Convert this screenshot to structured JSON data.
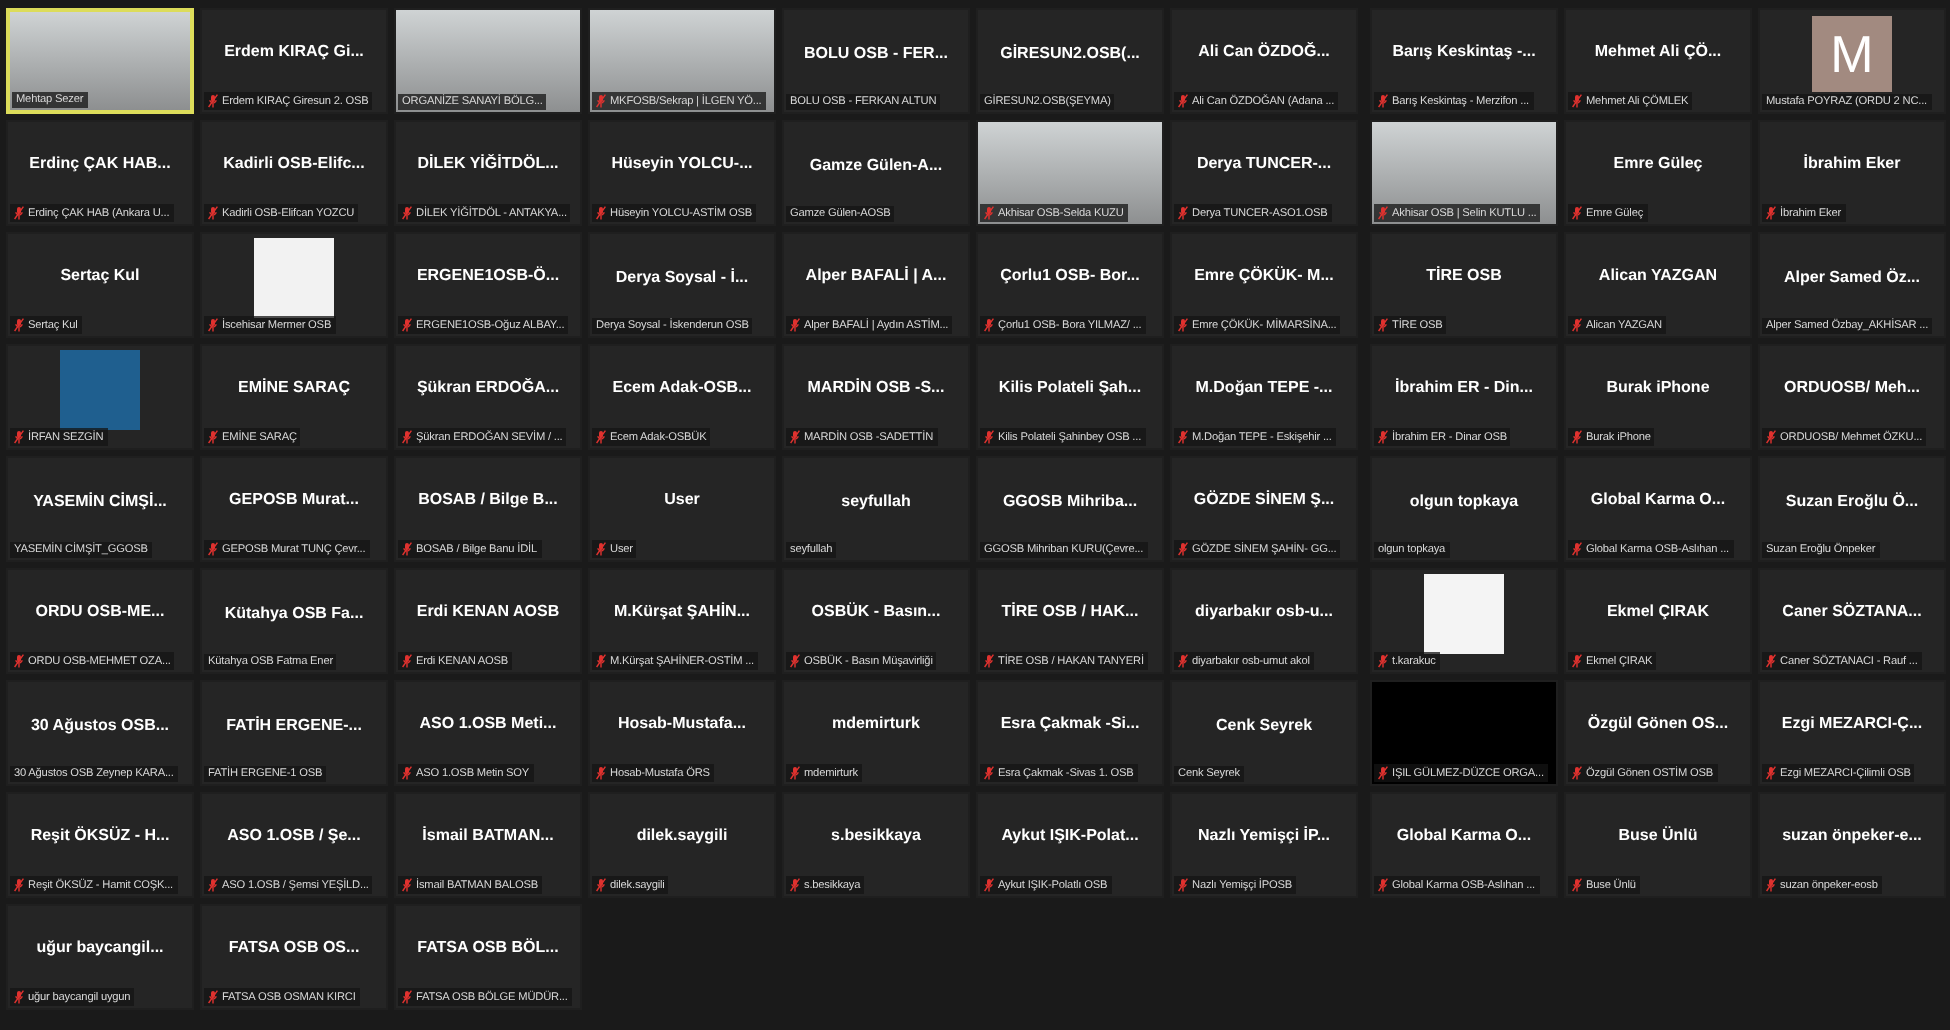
{
  "left_grid": [
    {
      "kind": "video",
      "label": "Mehtap Sezer",
      "muted": false,
      "speaking": true
    },
    {
      "kind": "name",
      "name": "Erdem KIRAÇ Gi...",
      "label": "Erdem KIRAÇ Giresun 2. OSB",
      "muted": true,
      "speaking": false
    },
    {
      "kind": "video",
      "label": "ORGANİZE SANAYİ BÖLG...",
      "muted": false,
      "speaking": false
    },
    {
      "kind": "video",
      "label": "MKFOSB/Sekrap | İLGEN YÖ...",
      "muted": true,
      "speaking": false
    },
    {
      "kind": "name",
      "name": "BOLU OSB - FER...",
      "label": "BOLU OSB - FERKAN ALTUN",
      "muted": false,
      "speaking": false
    },
    {
      "kind": "name",
      "name": "GİRESUN2.OSB(...",
      "label": "GİRESUN2.OSB(ŞEYMA)",
      "muted": false,
      "speaking": false
    },
    {
      "kind": "name",
      "name": "Ali Can ÖZDOĞ...",
      "label": "Ali Can ÖZDOĞAN (Adana ...",
      "muted": true,
      "speaking": false
    },
    {
      "kind": "name",
      "name": "Erdinç ÇAK HAB...",
      "label": "Erdinç ÇAK HAB (Ankara U...",
      "muted": true,
      "speaking": false
    },
    {
      "kind": "name",
      "name": "Kadirli OSB-Elifc...",
      "label": "Kadirli OSB-Elifcan YOZCU",
      "muted": true,
      "speaking": false
    },
    {
      "kind": "name",
      "name": "DİLEK YİĞİTDÖL...",
      "label": "DİLEK YİĞİTDÖL - ANTAKYA...",
      "muted": true,
      "speaking": false
    },
    {
      "kind": "name",
      "name": "Hüseyin YOLCU-...",
      "label": "Hüseyin YOLCU-ASTİM OSB",
      "muted": true,
      "speaking": false
    },
    {
      "kind": "name",
      "name": "Gamze Gülen-A...",
      "label": "Gamze Gülen-AOSB",
      "muted": false,
      "speaking": false
    },
    {
      "kind": "video",
      "label": "Akhisar OSB-Selda KUZU",
      "muted": true,
      "speaking": false
    },
    {
      "kind": "name",
      "name": "Derya TUNCER-...",
      "label": "Derya TUNCER-ASO1.OSB",
      "muted": true,
      "speaking": false
    },
    {
      "kind": "name",
      "name": "Sertaç Kul",
      "label": "Sertaç Kul",
      "muted": true,
      "speaking": false
    },
    {
      "kind": "logo",
      "color": "#f2f2f2",
      "label": "İscehisar Mermer OSB",
      "muted": true,
      "speaking": false
    },
    {
      "kind": "name",
      "name": "ERGENE1OSB-Ö...",
      "label": "ERGENE1OSB-Oğuz ALBAY...",
      "muted": true,
      "speaking": false
    },
    {
      "kind": "name",
      "name": "Derya Soysal - İ...",
      "label": "Derya Soysal - İskenderun OSB",
      "muted": false,
      "speaking": false
    },
    {
      "kind": "name",
      "name": "Alper BAFALİ | A...",
      "label": "Alper BAFALİ | Aydın ASTİM...",
      "muted": true,
      "speaking": false
    },
    {
      "kind": "name",
      "name": "Çorlu1 OSB- Bor...",
      "label": "Çorlu1 OSB- Bora YILMAZ/ ...",
      "muted": true,
      "speaking": false
    },
    {
      "kind": "name",
      "name": "Emre ÇÖKÜK- M...",
      "label": "Emre ÇÖKÜK- MİMARSİNA...",
      "muted": true,
      "speaking": false
    },
    {
      "kind": "logo",
      "color": "#1f5f8f",
      "label": "İRFAN SEZGİN",
      "muted": true,
      "speaking": false
    },
    {
      "kind": "name",
      "name": "EMİNE SARAÇ",
      "label": "EMİNE SARAÇ",
      "muted": true,
      "speaking": false
    },
    {
      "kind": "name",
      "name": "Şükran ERDOĞA...",
      "label": "Şükran ERDOĞAN SEVİM / ...",
      "muted": true,
      "speaking": false
    },
    {
      "kind": "name",
      "name": "Ecem Adak-OSB...",
      "label": "Ecem Adak-OSBÜK",
      "muted": true,
      "speaking": false
    },
    {
      "kind": "name",
      "name": "MARDİN OSB -S...",
      "label": "MARDİN OSB -SADETTİN",
      "muted": true,
      "speaking": false
    },
    {
      "kind": "name",
      "name": "Kilis Polateli Şah...",
      "label": "Kilis Polateli Şahinbey OSB ...",
      "muted": true,
      "speaking": false
    },
    {
      "kind": "name",
      "name": "M.Doğan TEPE -...",
      "label": "M.Doğan TEPE - Eskişehir ...",
      "muted": true,
      "speaking": false
    },
    {
      "kind": "name",
      "name": "YASEMİN CİMŞİ...",
      "label": "YASEMİN CİMŞİT_GGOSB",
      "muted": false,
      "speaking": false
    },
    {
      "kind": "name",
      "name": "GEPOSB Murat...",
      "label": "GEPOSB Murat TUNÇ Çevr...",
      "muted": true,
      "speaking": false
    },
    {
      "kind": "name",
      "name": "BOSAB / Bilge B...",
      "label": "BOSAB / Bilge Banu İDİL",
      "muted": true,
      "speaking": false
    },
    {
      "kind": "name",
      "name": "User",
      "label": "User",
      "muted": true,
      "speaking": false
    },
    {
      "kind": "name",
      "name": "seyfullah",
      "label": "seyfullah",
      "muted": false,
      "speaking": false
    },
    {
      "kind": "name",
      "name": "GGOSB Mihriba...",
      "label": "GGOSB Mihriban KURU(Çevre...",
      "muted": false,
      "speaking": false
    },
    {
      "kind": "name",
      "name": "GÖZDE SİNEM Ş...",
      "label": "GÖZDE SİNEM ŞAHİN- GG...",
      "muted": true,
      "speaking": false
    },
    {
      "kind": "name",
      "name": "ORDU OSB-ME...",
      "label": "ORDU OSB-MEHMET OZA...",
      "muted": true,
      "speaking": false
    },
    {
      "kind": "name",
      "name": "Kütahya OSB Fa...",
      "label": "Kütahya OSB Fatma Ener",
      "muted": false,
      "speaking": false
    },
    {
      "kind": "name",
      "name": "Erdi KENAN AOSB",
      "label": "Erdi KENAN AOSB",
      "muted": true,
      "speaking": false
    },
    {
      "kind": "name",
      "name": "M.Kürşat ŞAHİN...",
      "label": "M.Kürşat ŞAHİNER-OSTİM ...",
      "muted": true,
      "speaking": false
    },
    {
      "kind": "name",
      "name": "OSBÜK - Basın...",
      "label": "OSBÜK - Basın Müşavirliği",
      "muted": true,
      "speaking": false
    },
    {
      "kind": "name",
      "name": "TİRE OSB / HAK...",
      "label": "TİRE OSB / HAKAN TANYERİ",
      "muted": true,
      "speaking": false
    },
    {
      "kind": "name",
      "name": "diyarbakır osb-u...",
      "label": "diyarbakır osb-umut akol",
      "muted": true,
      "speaking": false
    },
    {
      "kind": "name",
      "name": "30 Ağustos OSB...",
      "label": "30 Ağustos OSB Zeynep KARA...",
      "muted": false,
      "speaking": false
    },
    {
      "kind": "name",
      "name": "FATİH ERGENE-...",
      "label": "FATİH ERGENE-1 OSB",
      "muted": false,
      "speaking": false
    },
    {
      "kind": "name",
      "name": "ASO 1.OSB Meti...",
      "label": "ASO 1.OSB Metin SOY",
      "muted": true,
      "speaking": false
    },
    {
      "kind": "name",
      "name": "Hosab-Mustafa...",
      "label": "Hosab-Mustafa ÖRS",
      "muted": true,
      "speaking": false
    },
    {
      "kind": "name",
      "name": "mdemirturk",
      "label": "mdemirturk",
      "muted": true,
      "speaking": false
    },
    {
      "kind": "name",
      "name": "Esra Çakmak -Si...",
      "label": "Esra Çakmak -Sivas 1. OSB",
      "muted": true,
      "speaking": false
    },
    {
      "kind": "name",
      "name": "Cenk Seyrek",
      "label": "Cenk Seyrek",
      "muted": false,
      "speaking": false
    },
    {
      "kind": "name",
      "name": "Reşit ÖKSÜZ - H...",
      "label": "Reşit ÖKSÜZ - Hamit COŞK...",
      "muted": true,
      "speaking": false
    },
    {
      "kind": "name",
      "name": "ASO 1.OSB / Şe...",
      "label": "ASO 1.OSB / Şemsi YEŞİLD...",
      "muted": true,
      "speaking": false
    },
    {
      "kind": "name",
      "name": "İsmail BATMAN...",
      "label": "İsmail BATMAN BALOSB",
      "muted": true,
      "speaking": false
    },
    {
      "kind": "name",
      "name": "dilek.saygili",
      "label": "dilek.saygili",
      "muted": true,
      "speaking": false
    },
    {
      "kind": "name",
      "name": "s.besikkaya",
      "label": "s.besikkaya",
      "muted": true,
      "speaking": false
    },
    {
      "kind": "name",
      "name": "Aykut IŞIK-Polat...",
      "label": "Aykut IŞIK-Polatlı OSB",
      "muted": true,
      "speaking": false
    },
    {
      "kind": "name",
      "name": "Nazlı Yemişçi İP...",
      "label": "Nazlı Yemişçi İPOSB",
      "muted": true,
      "speaking": false
    },
    {
      "kind": "name",
      "name": "uğur baycangil...",
      "label": "uğur baycangil uygun",
      "muted": true,
      "speaking": false
    },
    {
      "kind": "name",
      "name": "FATSA OSB OS...",
      "label": "FATSA OSB OSMAN KIRCI",
      "muted": true,
      "speaking": false
    },
    {
      "kind": "name",
      "name": "FATSA OSB BÖL...",
      "label": "FATSA OSB BÖLGE MÜDÜR...",
      "muted": true,
      "speaking": false
    }
  ],
  "right_grid": [
    {
      "kind": "name",
      "name": "Barış Keskintaş -...",
      "label": "Barış Keskintaş - Merzifon ...",
      "muted": true,
      "speaking": false
    },
    {
      "kind": "name",
      "name": "Mehmet Ali ÇÖ...",
      "label": "Mehmet Ali ÇÖMLEK",
      "muted": true,
      "speaking": false
    },
    {
      "kind": "avatar",
      "letter": "M",
      "label": "Mustafa POYRAZ (ORDU 2 NC...",
      "muted": false,
      "speaking": false
    },
    {
      "kind": "video",
      "label": "Akhisar OSB | Selin KUTLU ...",
      "muted": true,
      "speaking": false
    },
    {
      "kind": "name",
      "name": "Emre Güleç",
      "label": "Emre Güleç",
      "muted": true,
      "speaking": false
    },
    {
      "kind": "name",
      "name": "İbrahim Eker",
      "label": "İbrahim Eker",
      "muted": true,
      "speaking": false
    },
    {
      "kind": "name",
      "name": "TİRE OSB",
      "label": "TİRE OSB",
      "muted": true,
      "speaking": false
    },
    {
      "kind": "name",
      "name": "Alican YAZGAN",
      "label": "Alican YAZGAN",
      "muted": true,
      "speaking": false
    },
    {
      "kind": "name",
      "name": "Alper Samed Öz...",
      "label": "Alper Samed Özbay_AKHİSAR ...",
      "muted": false,
      "speaking": false
    },
    {
      "kind": "name",
      "name": "İbrahim ER - Din...",
      "label": "İbrahim ER - Dinar OSB",
      "muted": true,
      "speaking": false
    },
    {
      "kind": "name",
      "name": "Burak iPhone",
      "label": "Burak iPhone",
      "muted": true,
      "speaking": false
    },
    {
      "kind": "name",
      "name": "ORDUOSB/ Meh...",
      "label": "ORDUOSB/ Mehmet ÖZKU...",
      "muted": true,
      "speaking": false
    },
    {
      "kind": "name",
      "name": "olgun topkaya",
      "label": "olgun topkaya",
      "muted": false,
      "speaking": false
    },
    {
      "kind": "name",
      "name": "Global Karma O...",
      "label": "Global Karma OSB-Aslıhan ...",
      "muted": true,
      "speaking": false
    },
    {
      "kind": "name",
      "name": "Suzan Eroğlu Ö...",
      "label": "Suzan Eroğlu Önpeker",
      "muted": false,
      "speaking": false
    },
    {
      "kind": "logo",
      "color": "#f4f4f4",
      "label": "t.karakuc",
      "muted": true,
      "speaking": false
    },
    {
      "kind": "name",
      "name": "Ekmel ÇIRAK",
      "label": "Ekmel ÇIRAK",
      "muted": true,
      "speaking": false
    },
    {
      "kind": "name",
      "name": "Caner SÖZTANA...",
      "label": "Caner SÖZTANACI - Rauf ...",
      "muted": true,
      "speaking": false
    },
    {
      "kind": "blank",
      "label": "IŞIL GÜLMEZ-DÜZCE ORGA...",
      "muted": true,
      "speaking": false
    },
    {
      "kind": "name",
      "name": "Özgül Gönen OS...",
      "label": "Özgül Gönen OSTİM OSB",
      "muted": true,
      "speaking": false
    },
    {
      "kind": "name",
      "name": "Ezgi MEZARCI-Ç...",
      "label": "Ezgi MEZARCI-Çilimli OSB",
      "muted": true,
      "speaking": false
    },
    {
      "kind": "name",
      "name": "Global Karma O...",
      "label": "Global Karma OSB-Aslıhan ...",
      "muted": true,
      "speaking": false
    },
    {
      "kind": "name",
      "name": "Buse Ünlü",
      "label": "Buse Ünlü",
      "muted": true,
      "speaking": false
    },
    {
      "kind": "name",
      "name": "suzan önpeker-e...",
      "label": "suzan önpeker-eosb",
      "muted": true,
      "speaking": false
    }
  ]
}
